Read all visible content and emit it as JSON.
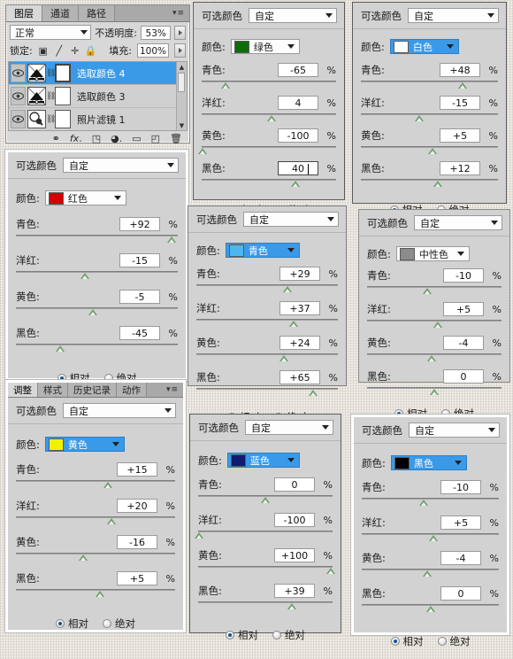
{
  "layers_panel": {
    "tabs": [
      {
        "label": "图层",
        "active": true
      },
      {
        "label": "通道",
        "active": false
      },
      {
        "label": "路径",
        "active": false
      }
    ],
    "menu_icon": "panel-menu-icon",
    "blend_mode": "正常",
    "opacity_label": "不透明度:",
    "opacity_value": "53%",
    "lock_label": "锁定:",
    "lock_icons": [
      "lock-transparent-icon",
      "lock-brush-icon",
      "lock-move-icon",
      "lock-all-icon"
    ],
    "fill_label": "填充:",
    "fill_value": "100%",
    "layers": [
      {
        "name": "选取颜色 4",
        "selected": true,
        "thumb": "adjustment-thumb"
      },
      {
        "name": "选取颜色 3",
        "selected": false,
        "thumb": "adjustment-thumb"
      },
      {
        "name": "照片滤镜 1",
        "selected": false,
        "thumb": "photo-filter-thumb"
      }
    ],
    "footer_icons": [
      "link-icon",
      "fx-icon",
      "mask-icon",
      "adjustment-icon",
      "group-icon",
      "new-layer-icon",
      "delete-icon"
    ]
  },
  "adjust_panel_tabs": [
    {
      "label": "调整",
      "active": true
    },
    {
      "label": "样式",
      "active": false
    },
    {
      "label": "历史记录",
      "active": false
    },
    {
      "label": "动作",
      "active": false
    }
  ],
  "labels": {
    "title": "可选颜色",
    "preset": "自定",
    "color_label": "颜色:",
    "cyan": "青色:",
    "magenta": "洋红:",
    "yellow": "黄色:",
    "black": "黑色:",
    "percent": "%",
    "relative": "相对",
    "absolute": "绝对"
  },
  "panels": [
    {
      "id": "green",
      "color_name": "绿色",
      "swatch": "#0b6e0b",
      "highlight": false,
      "preset": "自定",
      "method": "相对",
      "sliders": [
        {
          "key": "cyan",
          "value": "-65",
          "pos": 17.5,
          "editing": false
        },
        {
          "key": "magenta",
          "value": "4",
          "pos": 52.0,
          "editing": false
        },
        {
          "key": "yellow",
          "value": "-100",
          "pos": 0.5,
          "editing": false
        },
        {
          "key": "black",
          "value": "40",
          "pos": 70.0,
          "editing": true
        }
      ]
    },
    {
      "id": "white",
      "color_name": "白色",
      "swatch": "#ffffff",
      "highlight": true,
      "preset": "自定",
      "method": "相对",
      "sliders": [
        {
          "key": "cyan",
          "value": "+48",
          "pos": 74.0,
          "editing": false
        },
        {
          "key": "magenta",
          "value": "-15",
          "pos": 42.5,
          "editing": false
        },
        {
          "key": "yellow",
          "value": "+5",
          "pos": 52.5,
          "editing": false
        },
        {
          "key": "black",
          "value": "+12",
          "pos": 56.0,
          "editing": false
        }
      ]
    },
    {
      "id": "red",
      "color_name": "红色",
      "swatch": "#d40000",
      "highlight": false,
      "preset": "自定",
      "method": "相对",
      "sliders": [
        {
          "key": "cyan",
          "value": "+92",
          "pos": 96.0,
          "editing": false
        },
        {
          "key": "magenta",
          "value": "-15",
          "pos": 42.5,
          "editing": false
        },
        {
          "key": "yellow",
          "value": "-5",
          "pos": 47.5,
          "editing": false
        },
        {
          "key": "black",
          "value": "-45",
          "pos": 27.5,
          "editing": false
        }
      ]
    },
    {
      "id": "cyan",
      "color_name": "青色",
      "swatch": "#4db8f0",
      "highlight": true,
      "preset": "自定",
      "method": "相对",
      "sliders": [
        {
          "key": "cyan",
          "value": "+29",
          "pos": 64.5,
          "editing": false
        },
        {
          "key": "magenta",
          "value": "+37",
          "pos": 68.5,
          "editing": false
        },
        {
          "key": "yellow",
          "value": "+24",
          "pos": 62.0,
          "editing": false
        },
        {
          "key": "black",
          "value": "+65",
          "pos": 82.5,
          "editing": false
        }
      ]
    },
    {
      "id": "neutral",
      "color_name": "中性色",
      "swatch": "#8c8c8c",
      "highlight": false,
      "preset": "自定",
      "method": "相对",
      "sliders": [
        {
          "key": "cyan",
          "value": "-10",
          "pos": 45.0,
          "editing": false
        },
        {
          "key": "magenta",
          "value": "+5",
          "pos": 52.5,
          "editing": false
        },
        {
          "key": "yellow",
          "value": "-4",
          "pos": 48.0,
          "editing": false
        },
        {
          "key": "black",
          "value": "0",
          "pos": 50.0,
          "editing": false
        }
      ]
    },
    {
      "id": "yellow",
      "color_name": "黄色",
      "swatch": "#f2f200",
      "highlight": true,
      "preset": "自定",
      "method": "相对",
      "sliders": [
        {
          "key": "cyan",
          "value": "+15",
          "pos": 57.5,
          "editing": false
        },
        {
          "key": "magenta",
          "value": "+20",
          "pos": 60.0,
          "editing": false
        },
        {
          "key": "yellow",
          "value": "-16",
          "pos": 42.0,
          "editing": false
        },
        {
          "key": "black",
          "value": "+5",
          "pos": 52.5,
          "editing": false
        }
      ]
    },
    {
      "id": "blue",
      "color_name": "蓝色",
      "swatch": "#101a6e",
      "highlight": true,
      "preset": "自定",
      "method": "相对",
      "sliders": [
        {
          "key": "cyan",
          "value": "0",
          "pos": 50.0,
          "editing": false
        },
        {
          "key": "magenta",
          "value": "-100",
          "pos": 0.5,
          "editing": false
        },
        {
          "key": "yellow",
          "value": "+100",
          "pos": 99.0,
          "editing": false
        },
        {
          "key": "black",
          "value": "+39",
          "pos": 69.5,
          "editing": false
        }
      ]
    },
    {
      "id": "black",
      "color_name": "黑色",
      "swatch": "#000000",
      "highlight": true,
      "preset": "自定",
      "method": "相对",
      "sliders": [
        {
          "key": "cyan",
          "value": "-10",
          "pos": 45.0,
          "editing": false
        },
        {
          "key": "magenta",
          "value": "+5",
          "pos": 52.5,
          "editing": false
        },
        {
          "key": "yellow",
          "value": "-4",
          "pos": 48.0,
          "editing": false
        },
        {
          "key": "black",
          "value": "0",
          "pos": 50.0,
          "editing": false
        }
      ]
    }
  ]
}
